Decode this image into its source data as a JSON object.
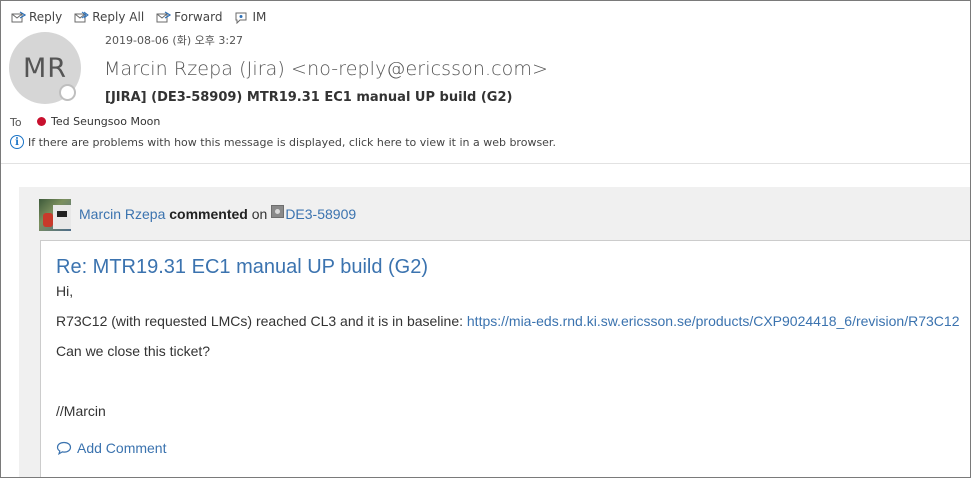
{
  "toolbar": {
    "reply": "Reply",
    "reply_all": "Reply All",
    "forward": "Forward",
    "im": "IM"
  },
  "header": {
    "avatar_initials": "MR",
    "datetime": "2019-08-06 (화) 오후 3:27",
    "sender": "Marcin Rzepa (Jira) <no-reply@ericsson.com>",
    "subject": "[JIRA] (DE3-58909) MTR19.31 EC1 manual UP build (G2)",
    "to_label": "To",
    "recipient": "Ted Seungsoo Moon",
    "info_message": "If there are problems with how this message is displayed, click here to view it in a web browser."
  },
  "jira": {
    "commenter": "Marcin Rzepa",
    "action": "commented",
    "on_text": "on",
    "issue_key": "DE3-58909",
    "title": "Re: MTR19.31 EC1 manual UP build (G2)",
    "greeting": "Hi,",
    "body_text": "R73C12 (with requested LMCs) reached CL3 and it is in baseline:",
    "body_link": "https://mia-eds.rnd.ki.sw.ericsson.se/products/CXP9024418_6/revision/R73C12",
    "question": "Can we close this ticket?",
    "signature": "//Marcin",
    "add_comment": "Add Comment"
  },
  "icons": {
    "reply": "reply-icon",
    "reply_all": "reply-all-icon",
    "forward": "forward-icon",
    "im": "im-icon",
    "info": "info-icon",
    "presence": "presence-icon",
    "comment": "comment-icon",
    "issue": "issue-type-icon"
  },
  "colors": {
    "link": "#3b73af",
    "presence_busy": "#c8102e",
    "info_blue": "#1a73c6"
  }
}
